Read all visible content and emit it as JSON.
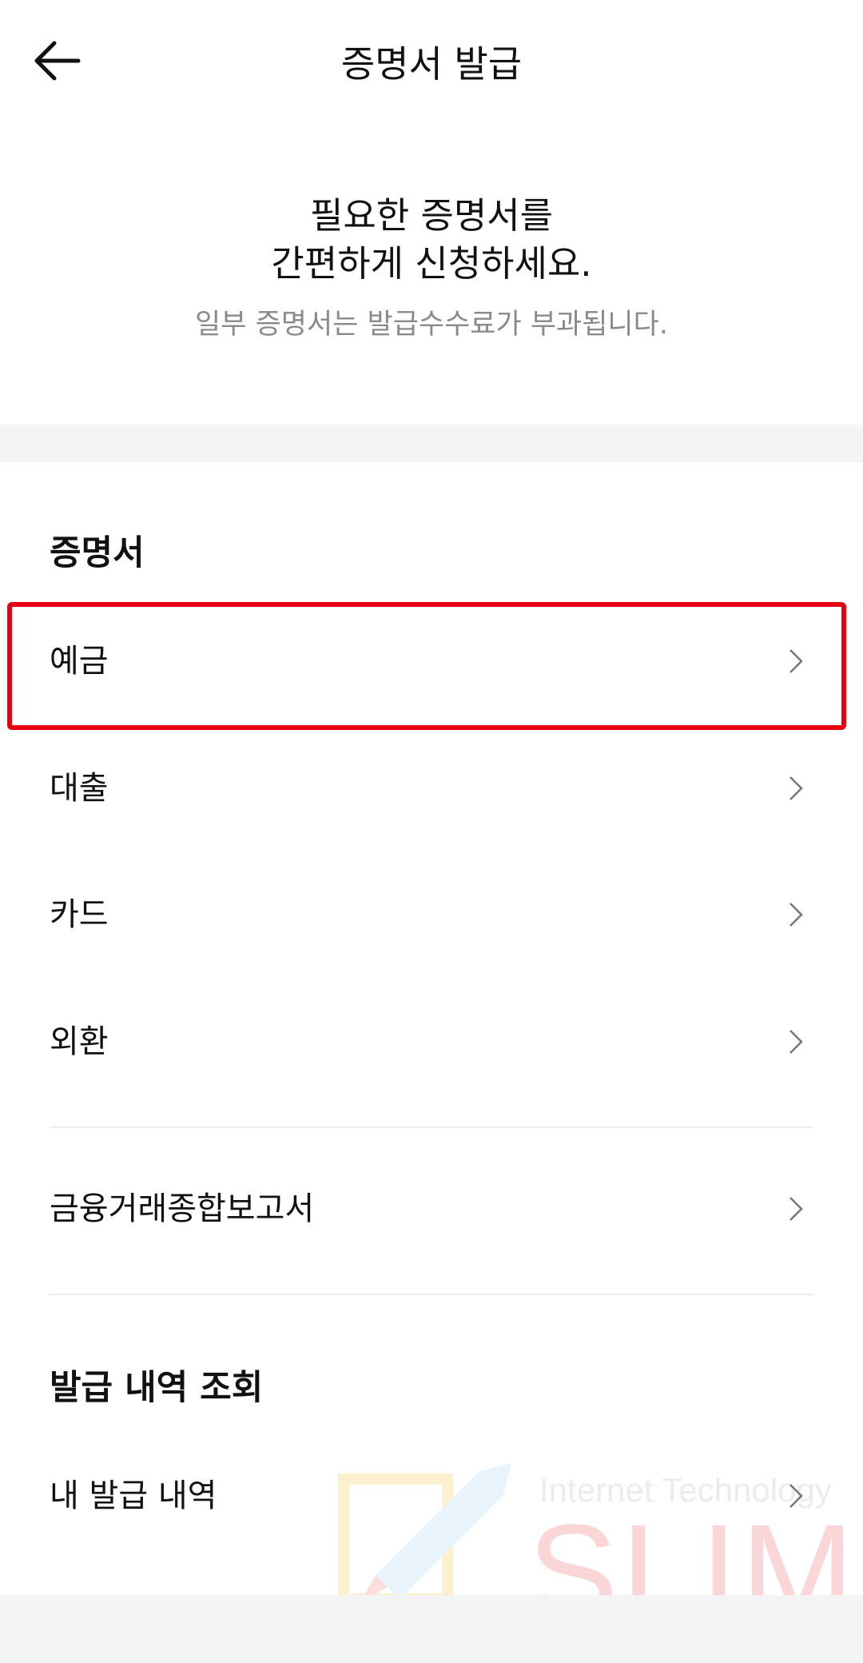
{
  "header": {
    "title": "증명서 발급",
    "back_icon": "arrow-left-icon"
  },
  "intro": {
    "line1": "필요한 증명서를",
    "line2": "간편하게 신청하세요.",
    "sub": "일부 증명서는 발급수수료가 부과됩니다."
  },
  "certificates": {
    "section_title": "증명서",
    "items": [
      {
        "label": "예금"
      },
      {
        "label": "대출"
      },
      {
        "label": "카드"
      },
      {
        "label": "외환"
      }
    ],
    "report_item": {
      "label": "금융거래종합보고서"
    }
  },
  "history": {
    "section_title": "발급 내역 조회",
    "items": [
      {
        "label": "내 발급 내역"
      }
    ]
  },
  "watermark": {
    "sub": "Internet Technology",
    "main": "SLIM"
  },
  "colors": {
    "highlight": "#e60012",
    "secondary_text": "#8a8a8a",
    "section_gap": "#f4f4f4"
  }
}
